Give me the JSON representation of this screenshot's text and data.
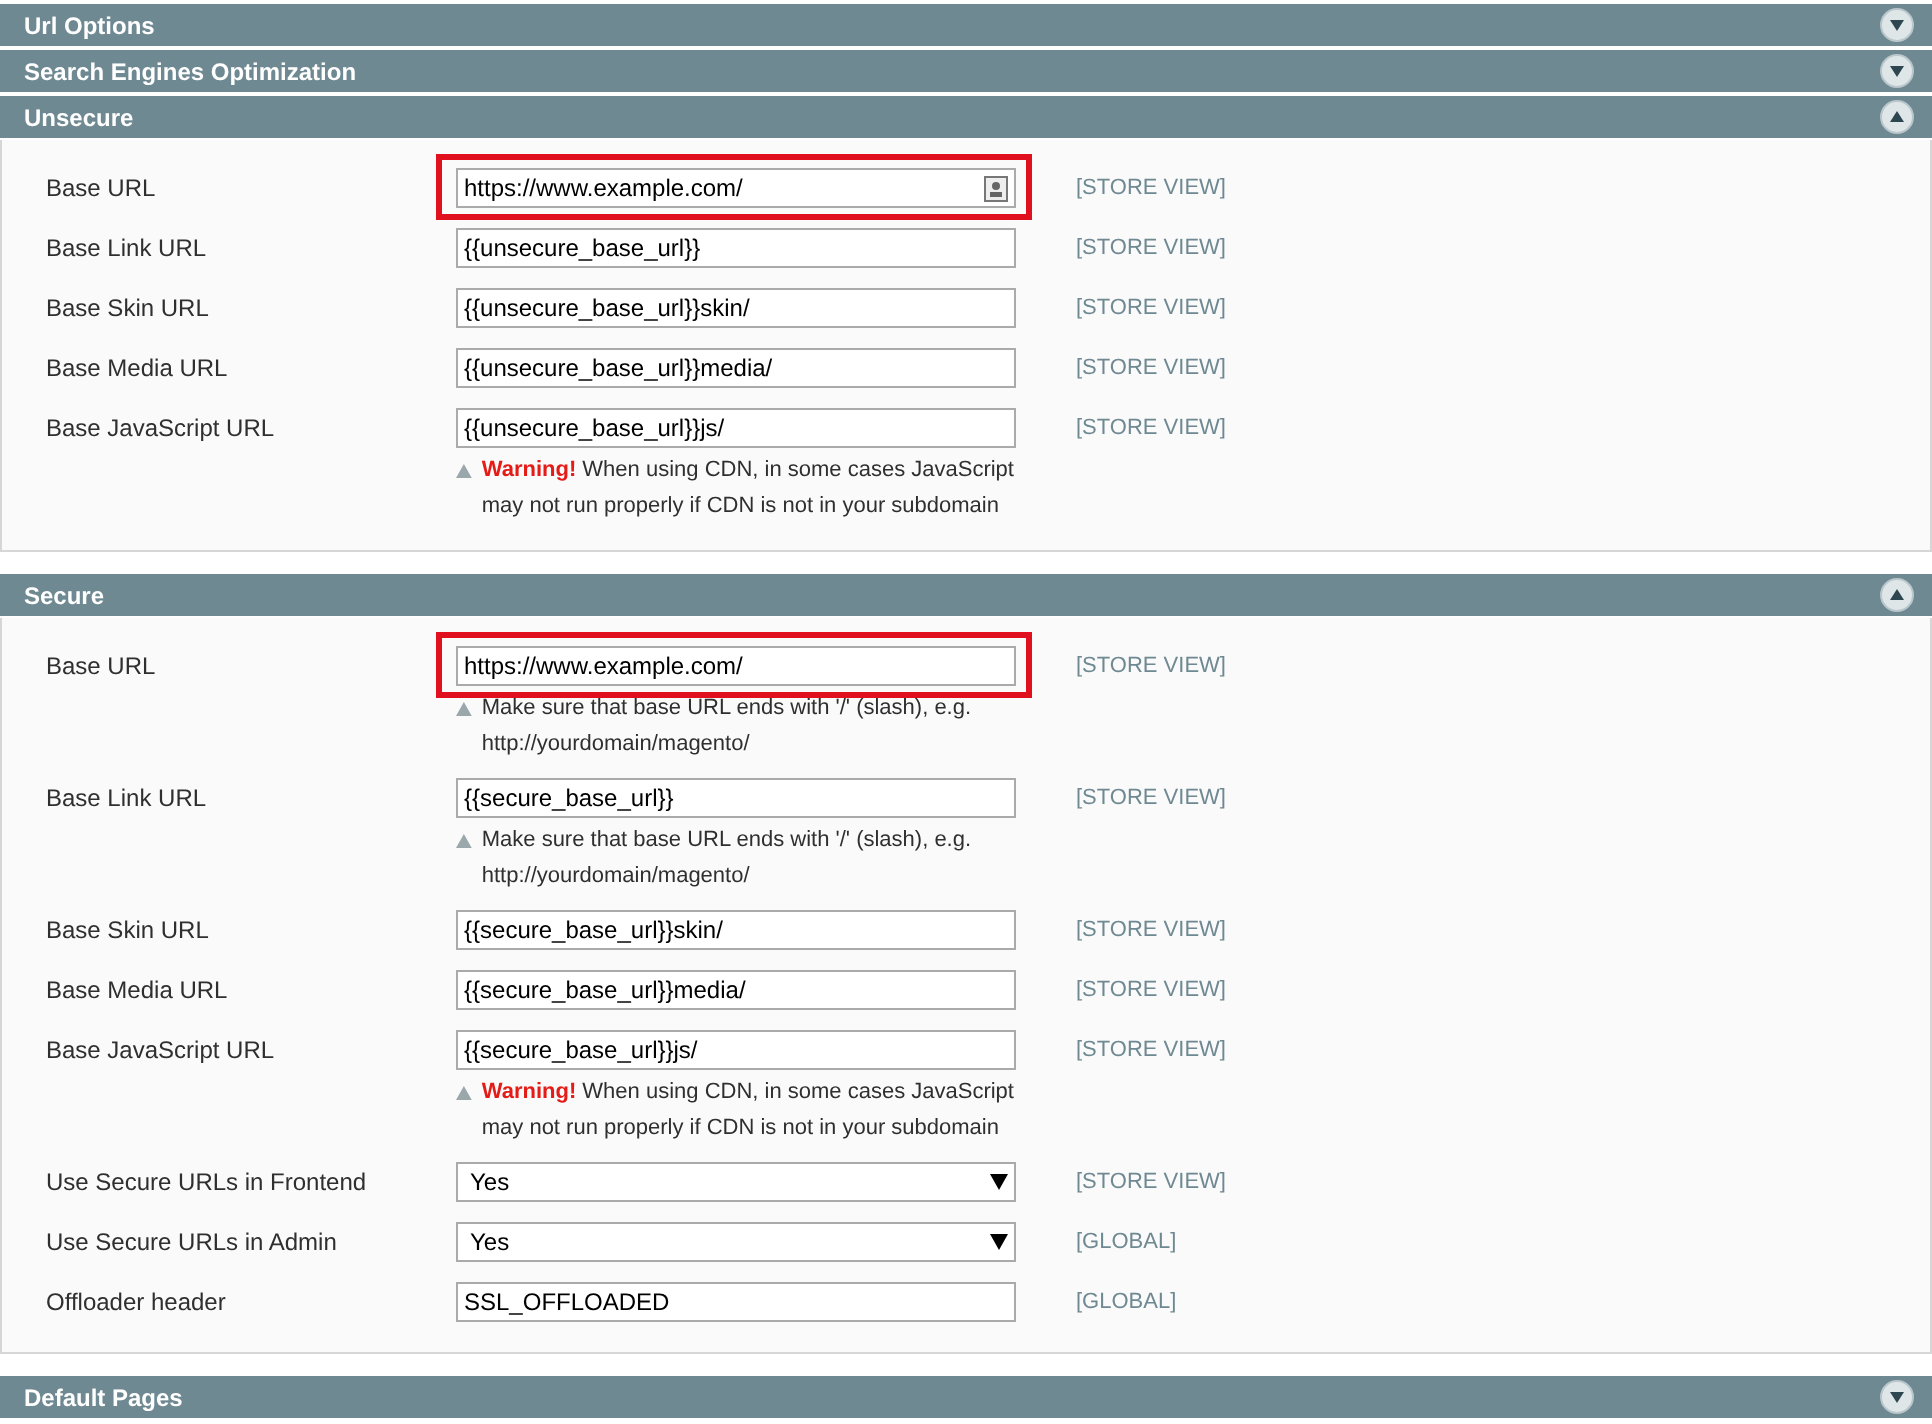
{
  "sections": [
    {
      "title": "Url Options",
      "expanded": false
    },
    {
      "title": "Search Engines Optimization",
      "expanded": false
    },
    {
      "title": "Unsecure",
      "expanded": true,
      "rows": [
        {
          "label": "Base URL",
          "kind": "text",
          "value": "https://www.example.com/",
          "scope": "[STORE VIEW]",
          "highlighted": true,
          "contact_icon": true
        },
        {
          "label": "Base Link URL",
          "kind": "text",
          "value": "{{unsecure_base_url}}",
          "scope": "[STORE VIEW]",
          "highlighted": false
        },
        {
          "label": "Base Skin URL",
          "kind": "text",
          "value": "{{unsecure_base_url}}skin/",
          "scope": "[STORE VIEW]",
          "highlighted": false
        },
        {
          "label": "Base Media URL",
          "kind": "text",
          "value": "{{unsecure_base_url}}media/",
          "scope": "[STORE VIEW]",
          "highlighted": false
        },
        {
          "label": "Base JavaScript URL",
          "kind": "text",
          "value": "{{unsecure_base_url}}js/",
          "scope": "[STORE VIEW]",
          "highlighted": false,
          "note": {
            "kind": "warning",
            "label": "Warning!",
            "text": "When using CDN, in some cases JavaScript may not run properly if CDN is not in your subdomain"
          }
        }
      ]
    },
    {
      "title": "Secure",
      "expanded": true,
      "rows": [
        {
          "label": "Base URL",
          "kind": "text",
          "value": "https://www.example.com/",
          "scope": "[STORE VIEW]",
          "highlighted": true,
          "note": {
            "kind": "hint",
            "text": "Make sure that base URL ends with '/' (slash), e.g. http://yourdomain/magento/"
          }
        },
        {
          "label": "Base Link URL",
          "kind": "text",
          "value": "{{secure_base_url}}",
          "scope": "[STORE VIEW]",
          "highlighted": false,
          "note": {
            "kind": "hint",
            "text": "Make sure that base URL ends with '/' (slash), e.g. http://yourdomain/magento/"
          }
        },
        {
          "label": "Base Skin URL",
          "kind": "text",
          "value": "{{secure_base_url}}skin/",
          "scope": "[STORE VIEW]",
          "highlighted": false
        },
        {
          "label": "Base Media URL",
          "kind": "text",
          "value": "{{secure_base_url}}media/",
          "scope": "[STORE VIEW]",
          "highlighted": false
        },
        {
          "label": "Base JavaScript URL",
          "kind": "text",
          "value": "{{secure_base_url}}js/",
          "scope": "[STORE VIEW]",
          "highlighted": false,
          "note": {
            "kind": "warning",
            "label": "Warning!",
            "text": "When using CDN, in some cases JavaScript may not run properly if CDN is not in your subdomain"
          }
        },
        {
          "label": "Use Secure URLs in Frontend",
          "kind": "select",
          "value": "Yes",
          "scope": "[STORE VIEW]",
          "highlighted": false
        },
        {
          "label": "Use Secure URLs in Admin",
          "kind": "select",
          "value": "Yes",
          "scope": "[GLOBAL]",
          "highlighted": false
        },
        {
          "label": "Offloader header",
          "kind": "text",
          "value": "SSL_OFFLOADED",
          "scope": "[GLOBAL]",
          "highlighted": false
        }
      ]
    },
    {
      "title": "Default Pages",
      "expanded": false
    }
  ]
}
